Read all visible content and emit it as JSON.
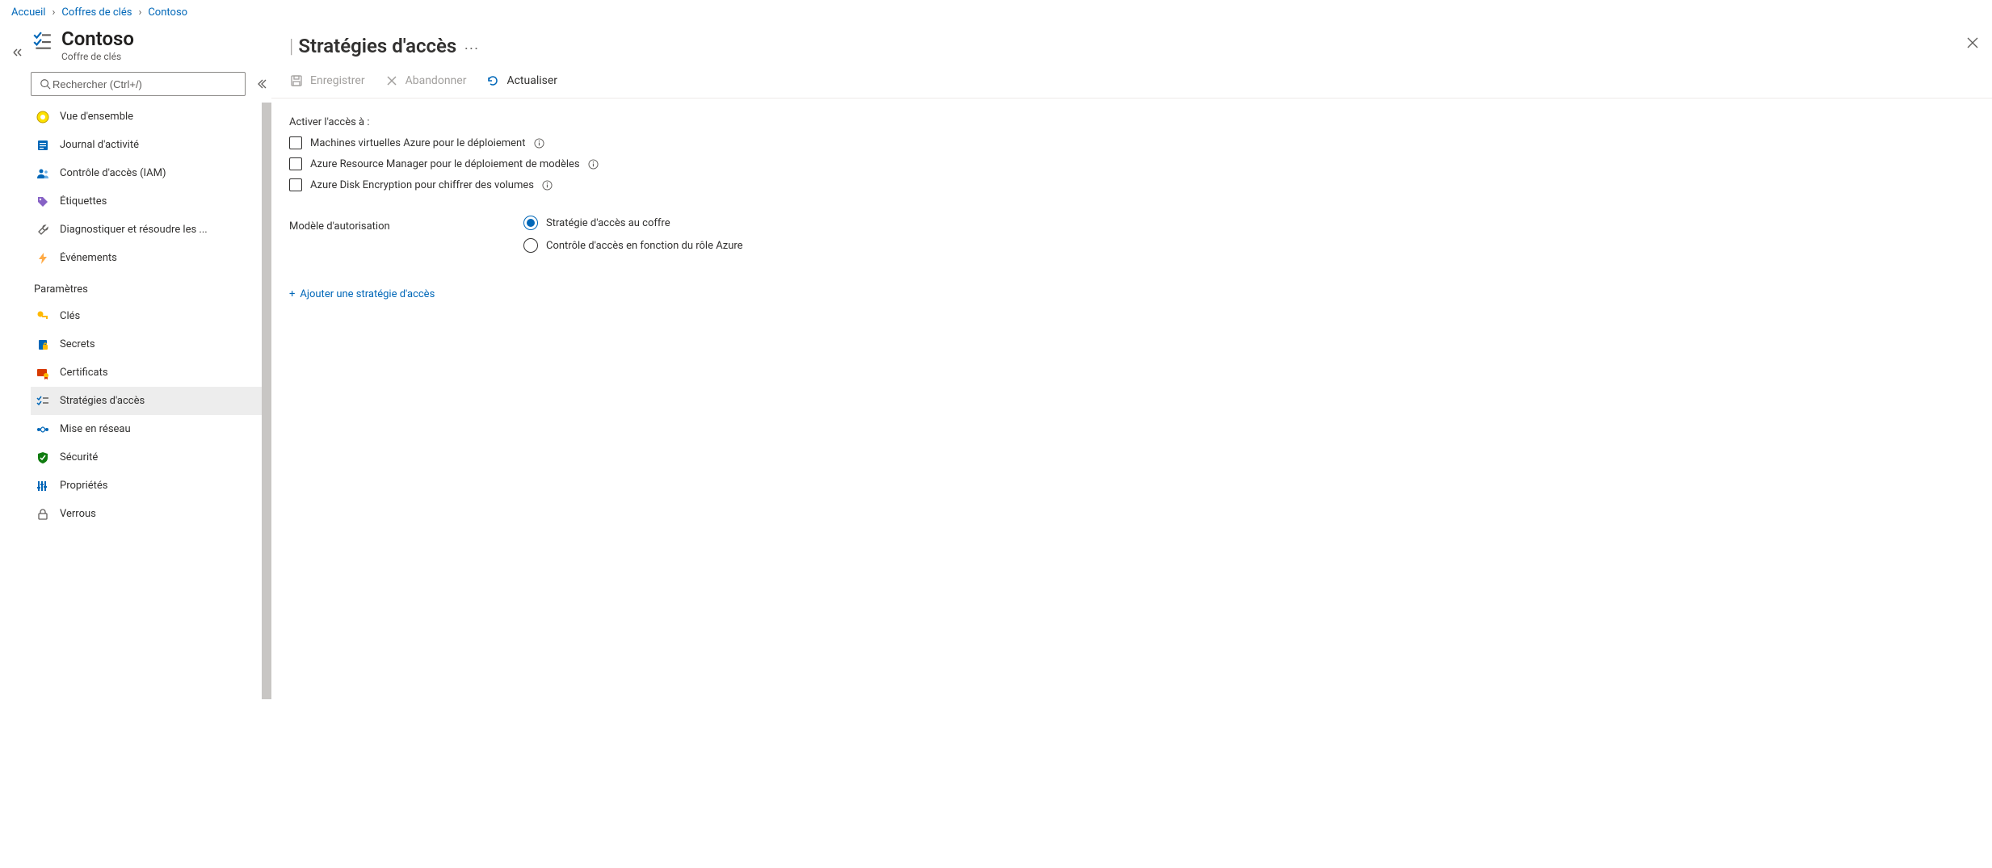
{
  "breadcrumb": {
    "items": [
      "Accueil",
      "Coffres de clés",
      "Contoso"
    ]
  },
  "resource": {
    "title": "Contoso",
    "subtitle": "Coffre de clés"
  },
  "search": {
    "placeholder": "Rechercher (Ctrl+/)"
  },
  "sidebar": {
    "items": [
      {
        "label": "Vue d'ensemble"
      },
      {
        "label": "Journal d'activité"
      },
      {
        "label": "Contrôle d'accès (IAM)"
      },
      {
        "label": "Étiquettes"
      },
      {
        "label": "Diagnostiquer et résoudre les ..."
      },
      {
        "label": "Événements"
      }
    ],
    "group_settings": "Paramètres",
    "settings_items": [
      {
        "label": "Clés"
      },
      {
        "label": "Secrets"
      },
      {
        "label": "Certificats"
      },
      {
        "label": "Stratégies d'accès"
      },
      {
        "label": "Mise en réseau"
      },
      {
        "label": "Sécurité"
      },
      {
        "label": "Propriétés"
      },
      {
        "label": "Verrous"
      }
    ]
  },
  "main": {
    "title": "Stratégies d'accès"
  },
  "toolbar": {
    "save": "Enregistrer",
    "discard": "Abandonner",
    "refresh": "Actualiser"
  },
  "content": {
    "enable_access_label": "Activer l'accès à :",
    "chk1": "Machines virtuelles Azure pour le déploiement",
    "chk2": "Azure Resource Manager pour le déploiement de modèles",
    "chk3": "Azure Disk Encryption pour chiffrer des volumes",
    "perm_model_label": "Modèle d'autorisation",
    "radio1": "Stratégie d'accès au coffre",
    "radio2": "Contrôle d'accès en fonction du rôle Azure",
    "add_policy": "Ajouter une stratégie d'accès"
  }
}
